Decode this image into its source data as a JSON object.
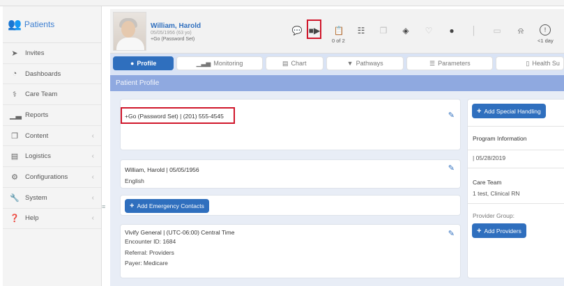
{
  "sidebar": {
    "brand": {
      "label": "Patients",
      "icon": "users-icon"
    },
    "items": [
      {
        "label": "Invites",
        "icon": "paper-plane-icon",
        "chevron": false
      },
      {
        "label": "Dashboards",
        "icon": "dashboard-icon",
        "chevron": false
      },
      {
        "label": "Care Team",
        "icon": "care-team-icon",
        "chevron": false
      },
      {
        "label": "Reports",
        "icon": "chart-icon",
        "chevron": false
      },
      {
        "label": "Content",
        "icon": "copy-icon",
        "chevron": true
      },
      {
        "label": "Logistics",
        "icon": "briefcase-icon",
        "chevron": true
      },
      {
        "label": "Configurations",
        "icon": "gears-icon",
        "chevron": true
      },
      {
        "label": "System",
        "icon": "wrench-icon",
        "chevron": true
      },
      {
        "label": "Help",
        "icon": "question-icon",
        "chevron": true
      }
    ]
  },
  "patient": {
    "name": "William, Harold",
    "dob": "05/05/1956 (63 yo)",
    "status": "+Go (Password Set)",
    "count_label": "0 of 2",
    "last_label": "<1 day"
  },
  "tabs": [
    {
      "label": "Profile",
      "icon": "user-icon",
      "active": true
    },
    {
      "label": "Monitoring",
      "icon": "bar-chart-icon",
      "active": false
    },
    {
      "label": "Chart",
      "icon": "clipboard-icon",
      "active": false
    },
    {
      "label": "Pathways",
      "icon": "map-marker-icon",
      "active": false
    },
    {
      "label": "Parameters",
      "icon": "sliders-icon",
      "active": false
    },
    {
      "label": "Health Su",
      "icon": "document-icon",
      "active": false
    }
  ],
  "section_title": "Patient Profile",
  "cards": {
    "contact": {
      "text": "+Go (Password Set) | (201) 555-4545"
    },
    "identity": {
      "line1": "William, Harold | 05/05/1956",
      "line2": "English"
    },
    "emergency": {
      "button_label": "Add Emergency Contacts"
    },
    "facility": {
      "line1": "Vivify General | (UTC-06:00) Central Time",
      "line2": "Encounter ID: 1684",
      "line3": "Referral: Providers",
      "line4": "Payer: Medicare"
    }
  },
  "right": {
    "special_handling_button": "Add Special Handling",
    "program_label": "Program Information",
    "program_date": "| 05/28/2019",
    "care_team_label": "Care Team",
    "care_team_value": "1 test, Clinical RN",
    "provider_group_label": "Provider Group:",
    "add_providers_button": "Add Providers"
  },
  "colors": {
    "accent": "#2f6fbe",
    "highlight": "#d0162a",
    "section": "#8fa9e0"
  }
}
